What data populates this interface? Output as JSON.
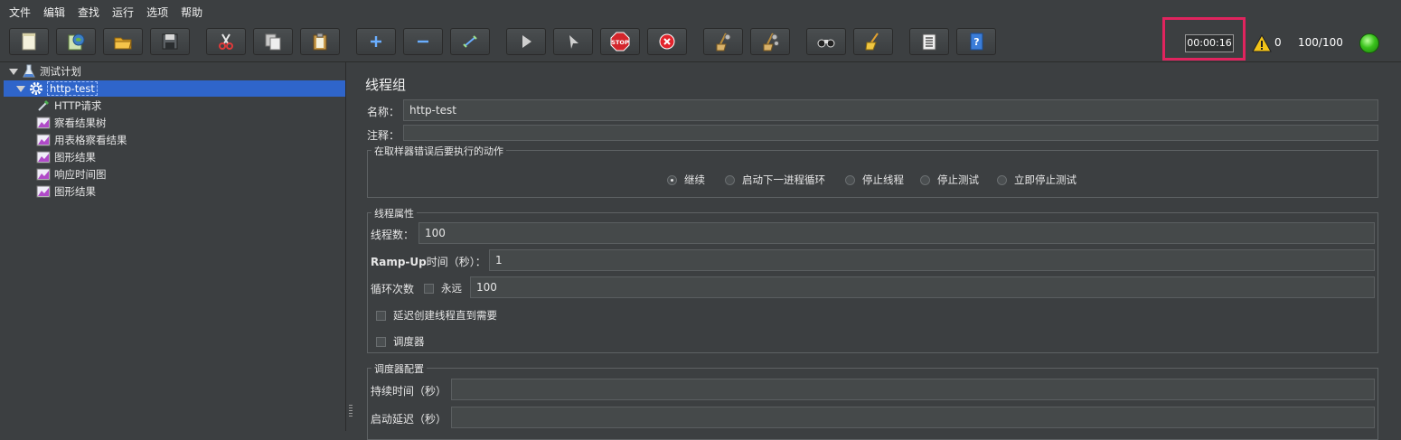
{
  "menu": [
    "文件",
    "编辑",
    "查找",
    "运行",
    "选项",
    "帮助"
  ],
  "toolbar": {
    "buttons": [
      {
        "name": "new-button",
        "icon": "new-file-icon"
      },
      {
        "name": "templates-button",
        "icon": "templates-icon"
      },
      {
        "name": "open-button",
        "icon": "folder-open-icon"
      },
      {
        "name": "save-button",
        "icon": "floppy-disk-icon"
      },
      {
        "name": "cut-button",
        "icon": "scissors-icon"
      },
      {
        "name": "copy-button",
        "icon": "copy-icon"
      },
      {
        "name": "paste-button",
        "icon": "clipboard-icon"
      },
      {
        "name": "expand-button",
        "icon": "plus-icon"
      },
      {
        "name": "collapse-button",
        "icon": "minus-icon"
      },
      {
        "name": "toggle-button",
        "icon": "wand-icon"
      },
      {
        "name": "start-button",
        "icon": "play-icon"
      },
      {
        "name": "start-no-pause-button",
        "icon": "play-no-pause-icon"
      },
      {
        "name": "stop-button",
        "icon": "stop-sign-icon"
      },
      {
        "name": "shutdown-button",
        "icon": "shutdown-icon"
      },
      {
        "name": "clear-button",
        "icon": "broom-gear-icon"
      },
      {
        "name": "clear-all-button",
        "icon": "broom-gears-icon"
      },
      {
        "name": "search-button",
        "icon": "binoculars-icon"
      },
      {
        "name": "reset-search-button",
        "icon": "broom-icon"
      },
      {
        "name": "function-helper-button",
        "icon": "list-icon"
      },
      {
        "name": "help-button",
        "icon": "help-book-icon"
      }
    ],
    "stop_label": "STOP"
  },
  "status": {
    "elapsed_time": "00:00:16",
    "warning_count": "0",
    "active_threads": "100/100",
    "highlight_color": "#e0245e",
    "running_color": "#39c21b"
  },
  "tree": {
    "root": "测试计划",
    "thread_group": "http-test",
    "children": [
      "HTTP请求",
      "察看结果树",
      "用表格察看结果",
      "图形结果",
      "响应时间图",
      "图形结果"
    ]
  },
  "panel": {
    "title": "线程组",
    "name_label": "名称：",
    "name_value": "http-test",
    "comment_label": "注释：",
    "comment_value": "",
    "error_action_legend": "在取样器错误后要执行的动作",
    "error_actions": [
      "继续",
      "启动下一进程循环",
      "停止线程",
      "停止测试",
      "立即停止测试"
    ],
    "selected_action": "继续",
    "thread_props_legend": "线程属性",
    "threads_label": "线程数：",
    "threads_value": "100",
    "rampup_label_bold": "Ramp-Up",
    "rampup_label_rest": "时间（秒）：",
    "rampup_value": "1",
    "loop_label": "循环次数",
    "forever_label": "永远",
    "loop_value": "100",
    "delay_create_label": "延迟创建线程直到需要",
    "scheduler_label": "调度器",
    "scheduler_legend": "调度器配置",
    "duration_label": "持续时间（秒）",
    "duration_value": "",
    "startup_delay_label": "启动延迟（秒）",
    "startup_delay_value": ""
  }
}
